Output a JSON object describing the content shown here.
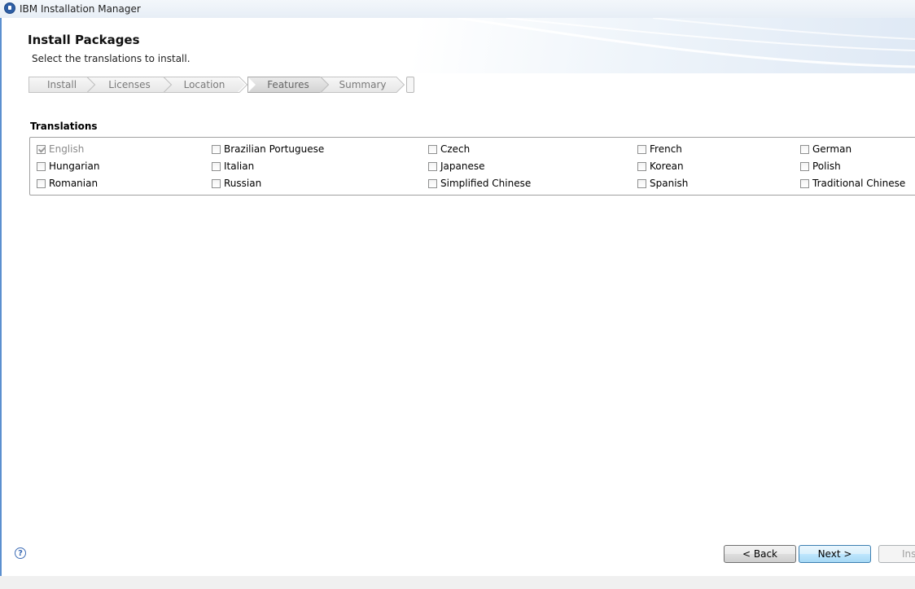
{
  "window": {
    "title": "IBM Installation Manager"
  },
  "page": {
    "title": "Install Packages",
    "subtitle": "Select the translations to install."
  },
  "steps": [
    {
      "label": "Install",
      "current": false
    },
    {
      "label": "Licenses",
      "current": false
    },
    {
      "label": "Location",
      "current": false
    },
    {
      "label": "Features",
      "current": true
    },
    {
      "label": "Summary",
      "current": false
    }
  ],
  "translations": {
    "label": "Translations",
    "options": [
      {
        "label": "English",
        "checked": true,
        "disabled": true
      },
      {
        "label": "Brazilian Portuguese",
        "checked": false,
        "disabled": false
      },
      {
        "label": "Czech",
        "checked": false,
        "disabled": false
      },
      {
        "label": "French",
        "checked": false,
        "disabled": false
      },
      {
        "label": "German",
        "checked": false,
        "disabled": false
      },
      {
        "label": "Hungarian",
        "checked": false,
        "disabled": false
      },
      {
        "label": "Italian",
        "checked": false,
        "disabled": false
      },
      {
        "label": "Japanese",
        "checked": false,
        "disabled": false
      },
      {
        "label": "Korean",
        "checked": false,
        "disabled": false
      },
      {
        "label": "Polish",
        "checked": false,
        "disabled": false
      },
      {
        "label": "Romanian",
        "checked": false,
        "disabled": false
      },
      {
        "label": "Russian",
        "checked": false,
        "disabled": false
      },
      {
        "label": "Simplified Chinese",
        "checked": false,
        "disabled": false
      },
      {
        "label": "Spanish",
        "checked": false,
        "disabled": false
      },
      {
        "label": "Traditional Chinese",
        "checked": false,
        "disabled": false
      }
    ]
  },
  "buttons": {
    "back": "< Back",
    "next": "Next >",
    "install": "Inst"
  },
  "icons": {
    "help": "help-icon",
    "app": "ibm-installation-manager-icon"
  },
  "colors": {
    "accent": "#5b8fcf",
    "default_button": "#3c7fb1"
  }
}
